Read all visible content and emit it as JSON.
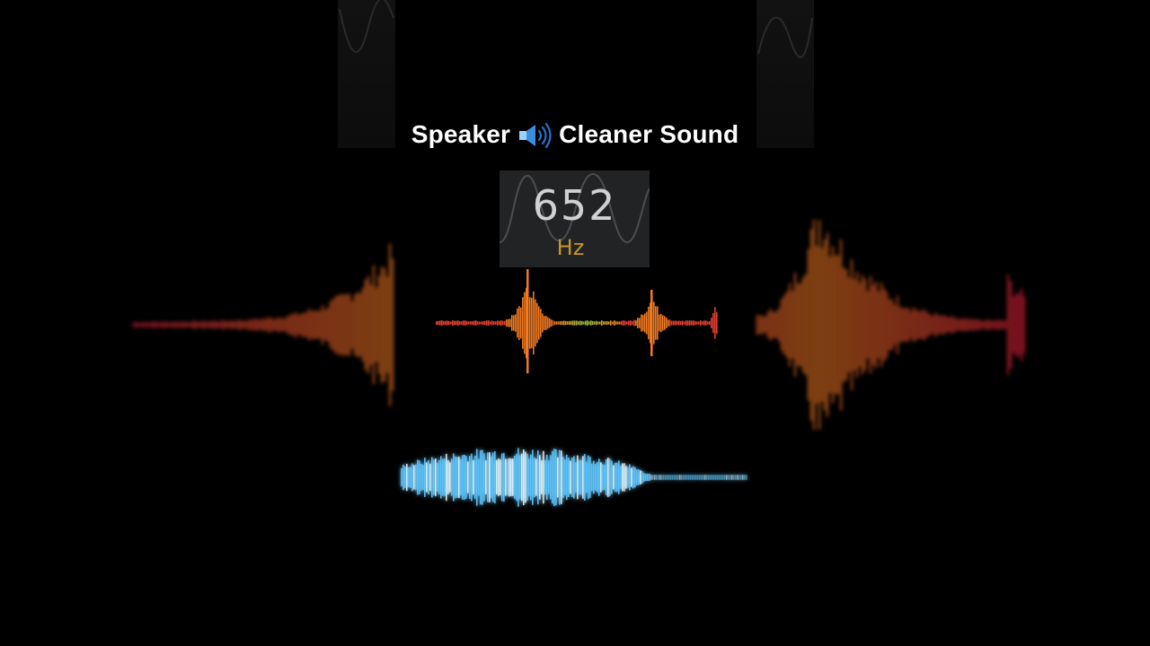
{
  "title": {
    "word_left": "Speaker",
    "icon": "speaker-icon",
    "word_right": "Cleaner Sound"
  },
  "frequency": {
    "value": "652",
    "unit": "Hz"
  },
  "colors": {
    "background": "#000000",
    "title_text": "#ffffff",
    "freq_value": "#cfd2d4",
    "freq_unit": "#c8952c",
    "freq_box": "#222324",
    "wave_hot": "#f07a22",
    "wave_cold": "#e01f3a",
    "wave_center": "#8fbf3a",
    "blue_wave": "#5ec8ff"
  }
}
